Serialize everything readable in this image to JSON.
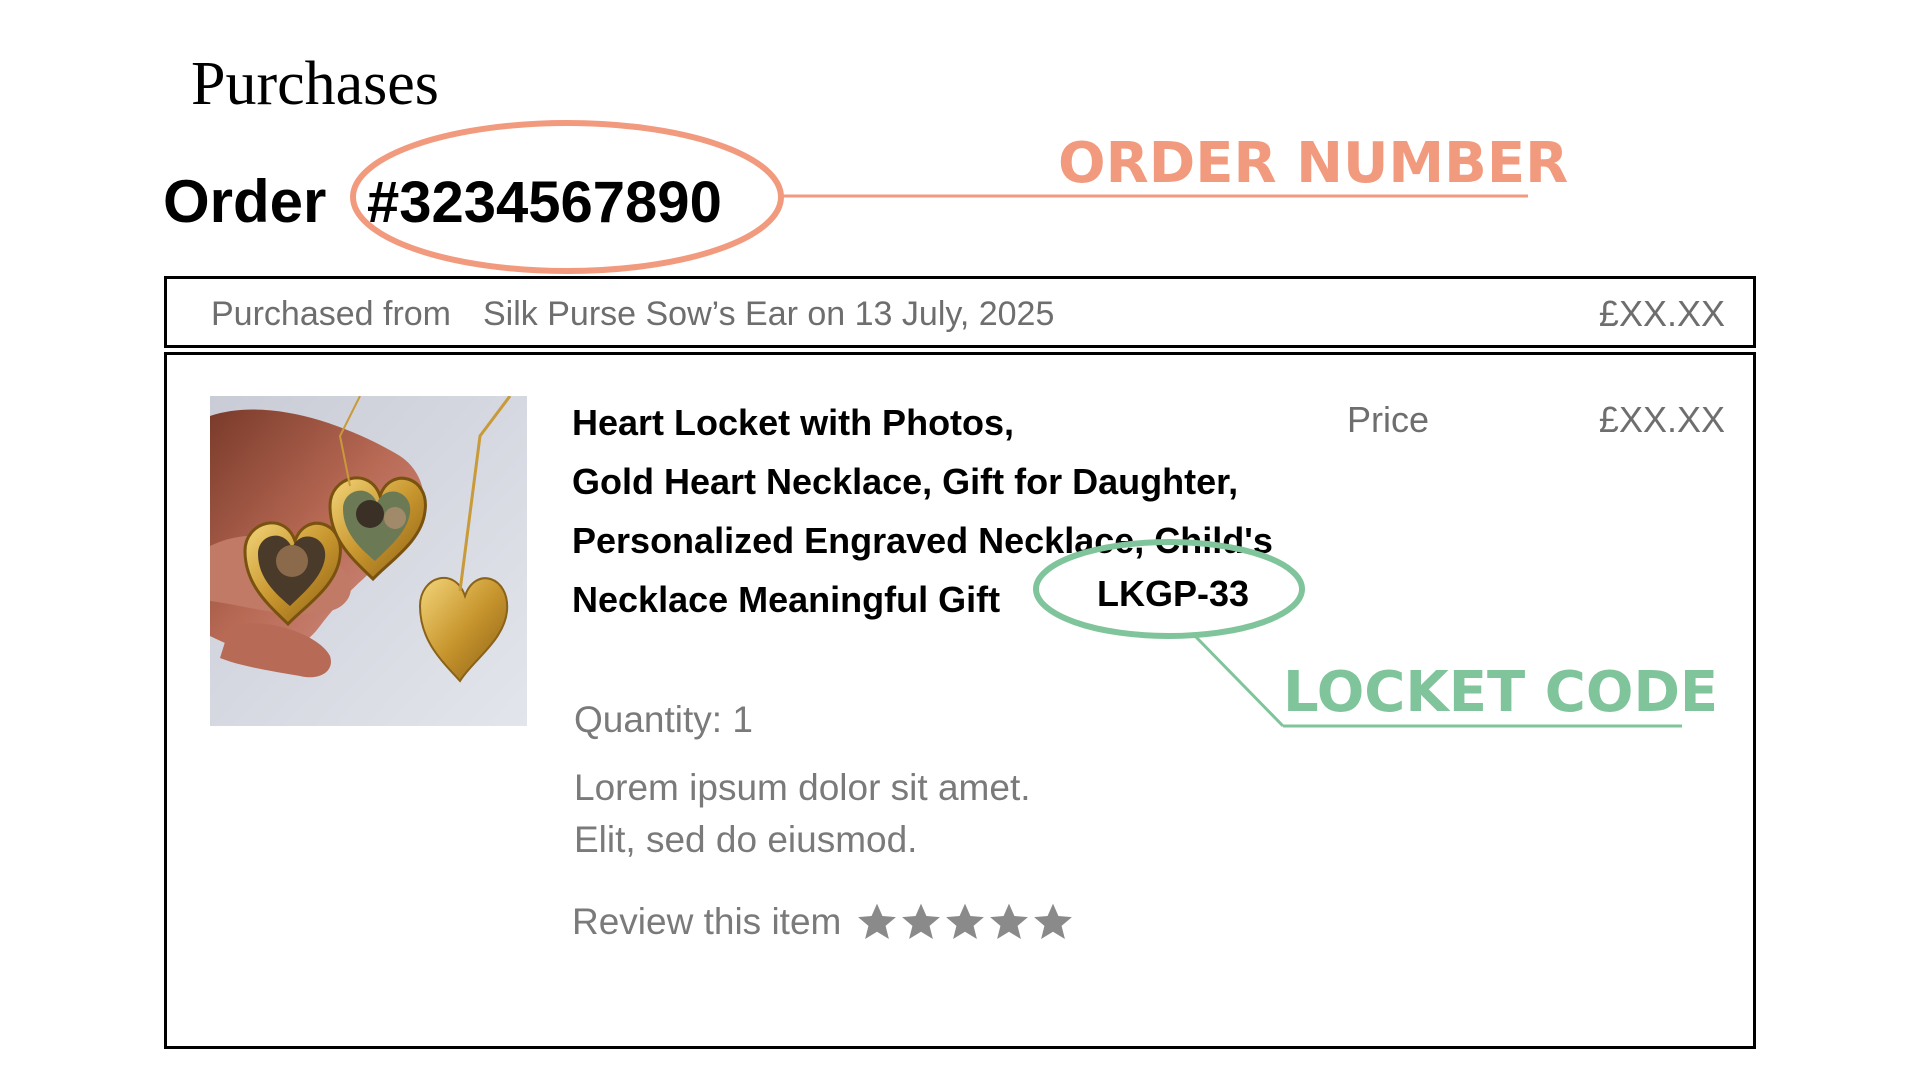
{
  "page": {
    "heading": "Purchases"
  },
  "order": {
    "label": "Order",
    "number": "#3234567890"
  },
  "annotations": {
    "order_number": "ORDER NUMBER",
    "locket_code": "LOCKET CODE",
    "order_color": "#f29a7e",
    "locket_color": "#7fc49a"
  },
  "summary": {
    "purchased_from_label": "Purchased from",
    "seller_and_date": "Silk Purse Sow’s Ear  on 13 July, 2025",
    "total": "£XX.XX"
  },
  "item": {
    "image_icon": "heart-locket-photo",
    "title_lines": [
      "Heart Locket with Photos,",
      "Gold Heart Necklace, Gift for Daughter,",
      "Personalized Engraved Necklace, Child's",
      "Necklace Meaningful Gift"
    ],
    "code": "LKGP-33",
    "price_label": "Price",
    "price_value": "£XX.XX",
    "quantity": "Quantity: 1",
    "description_lines": [
      "Lorem ipsum dolor sit amet.",
      "Elit, sed do eiusmod."
    ],
    "review_label": "Review this item",
    "rating": 0,
    "rating_max": 5,
    "star_color": "#8a8a8a"
  }
}
